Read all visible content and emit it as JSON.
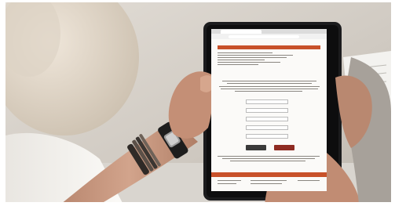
{
  "photo": {
    "subject": "",
    "colors": {
      "background_wall": "#d4cfc8",
      "shirt": "#f4f2ee",
      "skin": "#c99a82",
      "tablet_body": "#1b1b1d",
      "screen_bg": "#fbfaf8",
      "accent_orange": "#c8512a",
      "button_dark": "#3a3a3a",
      "button_red": "#8e2b22",
      "bracelet": "#3b3632",
      "watch": "#1d1d1d"
    }
  },
  "tablet_screen": {
    "browser_tab_title": "",
    "url": "",
    "banner_text": "",
    "section_title": "",
    "form_labels": [
      "",
      "",
      "",
      "",
      ""
    ],
    "primary_button_label": "",
    "secondary_button_label": "",
    "bottom_link_text": ""
  }
}
